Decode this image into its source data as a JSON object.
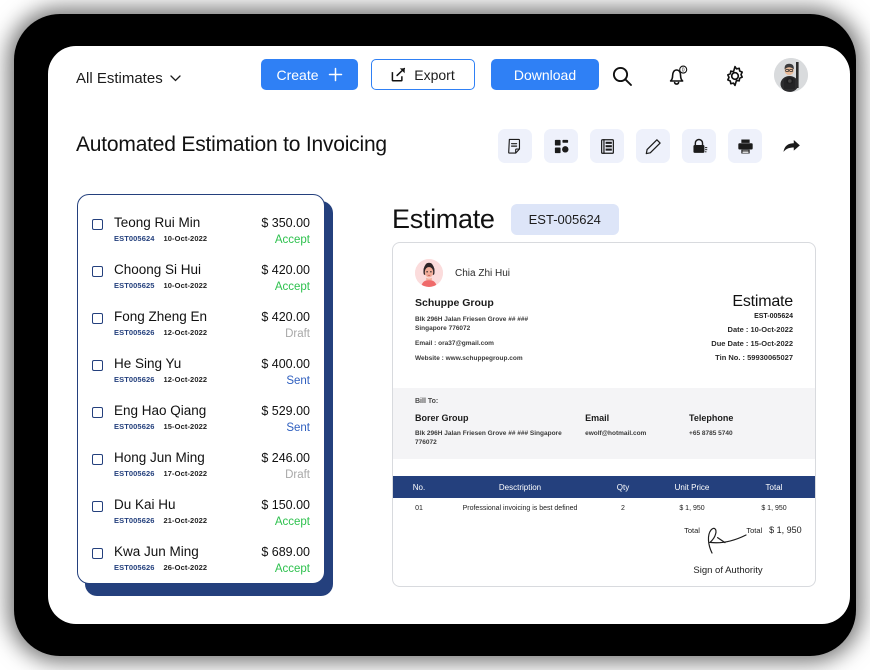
{
  "app": {
    "colors": {
      "primary_blue": "#2f80f5",
      "navy": "#24407d",
      "badge_bg": "#dde5f8",
      "accept_green": "#2ec14e",
      "draft_gray": "#a8a8a8",
      "sent_blue": "#2f5fbf"
    }
  },
  "topbar": {
    "filter_label": "All Estimates",
    "filter_chevron": "▼",
    "create_label": "Create",
    "create_icon": "plus-icon",
    "export_label": "Export",
    "export_icon": "export-share-icon",
    "download_label": "Download",
    "icons": [
      {
        "name": "search-icon"
      },
      {
        "name": "notification-bell-icon",
        "badge": "0"
      },
      {
        "name": "settings-gear-icon"
      }
    ],
    "avatar_name": "user-avatar"
  },
  "page": {
    "title": "Automated Estimation to Invoicing"
  },
  "toolbar": {
    "items": [
      {
        "name": "note-document-icon"
      },
      {
        "name": "dashboard-grid-icon"
      },
      {
        "name": "list-view-icon"
      },
      {
        "name": "edit-pencil-icon"
      },
      {
        "name": "lock-secure-icon"
      },
      {
        "name": "print-icon"
      },
      {
        "name": "share-arrow-icon"
      }
    ]
  },
  "estimate_list": {
    "rows": [
      {
        "name": "Teong Rui Min",
        "id": "EST005624",
        "date": "10-Oct-2022",
        "amount": "$ 350.00",
        "status": "Accept",
        "status_type": "accept"
      },
      {
        "name": "Choong Si Hui",
        "id": "EST005625",
        "date": "10-Oct-2022",
        "amount": "$ 420.00",
        "status": "Accept",
        "status_type": "accept"
      },
      {
        "name": "Fong Zheng En",
        "id": "EST005626",
        "date": "12-Oct-2022",
        "amount": "$ 420.00",
        "status": "Draft",
        "status_type": "draft"
      },
      {
        "name": "He Sing Yu",
        "id": "EST005626",
        "date": "12-Oct-2022",
        "amount": "$ 400.00",
        "status": "Sent",
        "status_type": "sent"
      },
      {
        "name": "Eng Hao Qiang",
        "id": "EST005626",
        "date": "15-Oct-2022",
        "amount": "$ 529.00",
        "status": "Sent",
        "status_type": "sent"
      },
      {
        "name": "Hong Jun Ming",
        "id": "EST005626",
        "date": "17-Oct-2022",
        "amount": "$ 246.00",
        "status": "Draft",
        "status_type": "draft"
      },
      {
        "name": "Du Kai Hu",
        "id": "EST005626",
        "date": "21-Oct-2022",
        "amount": "$ 150.00",
        "status": "Accept",
        "status_type": "accept"
      },
      {
        "name": "Kwa Jun Ming",
        "id": "EST005626",
        "date": "26-Oct-2022",
        "amount": "$ 689.00",
        "status": "Accept",
        "status_type": "accept"
      }
    ]
  },
  "estimate_panel": {
    "heading": "Estimate",
    "badge": "EST-005624"
  },
  "document": {
    "author_name": "Chia Zhi Hui",
    "from": {
      "company": "Schuppe Group",
      "address_line1": "Blk 296H Jalan Friesen Grove ## ###",
      "address_line2": "Singapore 776072",
      "email": "Email : ora37@gmail.com",
      "website": "Website : www.schuppegroup.com"
    },
    "meta": {
      "title": "Estimate",
      "id": "EST-005624",
      "date": "Date : 10-Oct-2022",
      "due_date": "Due Date : 15-Oct-2022",
      "tin": "Tin No. : 59930065027"
    },
    "bill_to": {
      "label": "Bill To:",
      "company": "Borer Group",
      "address": "Blk 296H Jalan Friesen Grove ## ### Singapore 776072",
      "email_label": "Email",
      "email_value": "ewolf@hotmail.com",
      "telephone_label": "Telephone",
      "telephone_value": "+65 8785 5740"
    },
    "table": {
      "headers": [
        "No.",
        "Desctription",
        "Qty",
        "Unit Price",
        "Total"
      ],
      "rows": [
        {
          "no": "01",
          "description": "Professional invoicing is best defined",
          "qty": "2",
          "unit_price": "$ 1, 950",
          "total": "$ 1, 950"
        }
      ],
      "total_label_left": "Total",
      "total_label_right": "Total",
      "total_value": "$ 1, 950"
    },
    "signature_label": "Sign of Authority"
  }
}
